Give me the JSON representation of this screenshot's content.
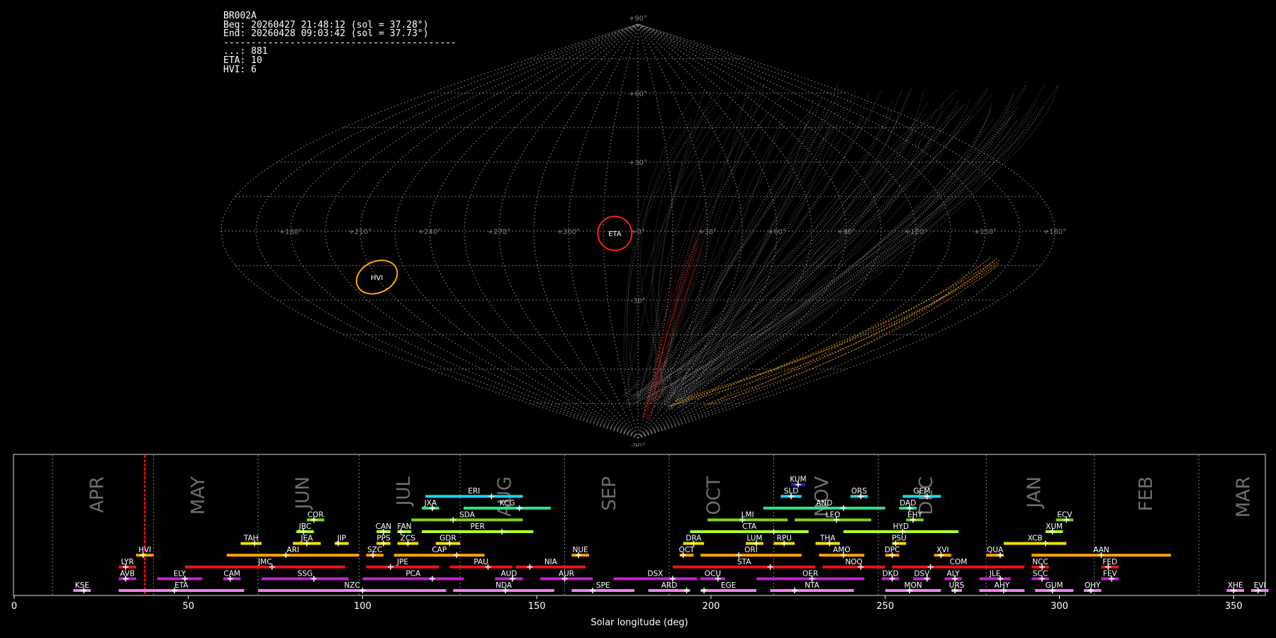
{
  "header": {
    "station": "BR002A",
    "beg": "Beg: 20260427 21:48:12 (sol = 37.28°)",
    "end": "End: 20260428 09:03:42 (sol = 37.73°)",
    "separator": "------------------------------------------",
    "counts": [
      "...: 881",
      "ETA: 10",
      "HVI: 6"
    ]
  },
  "sky_map": {
    "projection": "sinusoidal",
    "lon_labels": [
      "+180°",
      "+150°",
      "+120°",
      "+90°",
      "+60°",
      "+30°",
      "+0°",
      "+300°",
      "+270°",
      "+240°",
      "+210°",
      "+180°"
    ],
    "lat_labels": [
      "+90°",
      "+60°",
      "+30°",
      "-30°",
      "-90°"
    ],
    "active_showers": [
      {
        "code": "ETA",
        "lon": -10,
        "lat": -1,
        "color": "#ff2020"
      },
      {
        "code": "HVI",
        "lon": -120,
        "lat": -20,
        "color": "#ffa500"
      }
    ],
    "colors": {
      "grid": "#808080",
      "trails": "#9a9a9a",
      "eta": "#ff2020",
      "hvi": "#ffa500"
    }
  },
  "chart_data": {
    "type": "timeline",
    "xlabel": "Solar longitude (deg)",
    "xlim": [
      0,
      362
    ],
    "xticks": [
      0,
      50,
      100,
      150,
      200,
      250,
      300,
      350
    ],
    "current_sol": 37.5,
    "month_lines": [
      11,
      40,
      70,
      99,
      128,
      158,
      188,
      218,
      248,
      279,
      310,
      340
    ],
    "months": [
      {
        "label": "APR",
        "sol": 24
      },
      {
        "label": "MAY",
        "sol": 53
      },
      {
        "label": "JUN",
        "sol": 83
      },
      {
        "label": "JUL",
        "sol": 112
      },
      {
        "label": "AUG",
        "sol": 141
      },
      {
        "label": "SEP",
        "sol": 171
      },
      {
        "label": "OCT",
        "sol": 201
      },
      {
        "label": "NOV",
        "sol": 232
      },
      {
        "label": "DEC",
        "sol": 262
      },
      {
        "label": "JAN",
        "sol": 293
      },
      {
        "label": "FEB",
        "sol": 325
      },
      {
        "label": "MAR",
        "sol": 353
      }
    ],
    "showers": [
      {
        "code": "KSE",
        "start": 17,
        "end": 22,
        "peak": 20,
        "row": 0,
        "color": "#ee82ee"
      },
      {
        "code": "ETA",
        "start": 30,
        "end": 66,
        "peak": 46,
        "row": 0,
        "color": "#ee82ee"
      },
      {
        "code": "NZC",
        "start": 70,
        "end": 124,
        "peak": 100,
        "row": 0,
        "color": "#ee82ee"
      },
      {
        "code": "NDA",
        "start": 126,
        "end": 155,
        "peak": 141,
        "row": 0,
        "color": "#ee82ee"
      },
      {
        "code": "SPE",
        "start": 160,
        "end": 178,
        "peak": 166,
        "row": 0,
        "color": "#ee82ee"
      },
      {
        "code": "ARD",
        "start": 182,
        "end": 194,
        "peak": 193,
        "row": 0,
        "color": "#ee82ee"
      },
      {
        "code": "EGE",
        "start": 197,
        "end": 213,
        "peak": 198,
        "row": 0,
        "color": "#ee82ee"
      },
      {
        "code": "NTA",
        "start": 217,
        "end": 241,
        "peak": 224,
        "row": 0,
        "color": "#ee82ee"
      },
      {
        "code": "MON",
        "start": 250,
        "end": 266,
        "peak": 257,
        "row": 0,
        "color": "#ee82ee"
      },
      {
        "code": "URS",
        "start": 269,
        "end": 272,
        "peak": 270,
        "row": 0,
        "color": "#ee82ee"
      },
      {
        "code": "AHY",
        "start": 277,
        "end": 290,
        "peak": 284,
        "row": 0,
        "color": "#ee82ee"
      },
      {
        "code": "GUM",
        "start": 293,
        "end": 304,
        "peak": 298,
        "row": 0,
        "color": "#ee82ee"
      },
      {
        "code": "OHY",
        "start": 307,
        "end": 312,
        "peak": 309,
        "row": 0,
        "color": "#ee82ee"
      },
      {
        "code": "XHE",
        "start": 348,
        "end": 353,
        "peak": 350,
        "row": 0,
        "color": "#ee82ee"
      },
      {
        "code": "EVI",
        "start": 355,
        "end": 360,
        "peak": 357,
        "row": 0,
        "color": "#ee82ee"
      },
      {
        "code": "AVB",
        "start": 30,
        "end": 35,
        "peak": 32,
        "row": 1,
        "color": "#c71fd6"
      },
      {
        "code": "ELY",
        "start": 41,
        "end": 54,
        "peak": 49,
        "row": 1,
        "color": "#c71fd6"
      },
      {
        "code": "CAM",
        "start": 60,
        "end": 65,
        "peak": 62,
        "row": 1,
        "color": "#c71fd6"
      },
      {
        "code": "SSG",
        "start": 71,
        "end": 96,
        "peak": 86,
        "row": 1,
        "color": "#c71fd6"
      },
      {
        "code": "PCA",
        "start": 100,
        "end": 129,
        "peak": 120,
        "row": 1,
        "color": "#c71fd6"
      },
      {
        "code": "AUD",
        "start": 138,
        "end": 146,
        "peak": 143,
        "row": 1,
        "color": "#c71fd6"
      },
      {
        "code": "AUR",
        "start": 151,
        "end": 166,
        "peak": 158,
        "row": 1,
        "color": "#c71fd6"
      },
      {
        "code": "DSX",
        "start": 172,
        "end": 196,
        "peak": 189,
        "row": 1,
        "color": "#c71fd6"
      },
      {
        "code": "OCU",
        "start": 197,
        "end": 204,
        "peak": 202,
        "row": 1,
        "color": "#c71fd6"
      },
      {
        "code": "OER",
        "start": 213,
        "end": 244,
        "peak": 229,
        "row": 1,
        "color": "#c71fd6"
      },
      {
        "code": "DKD",
        "start": 249,
        "end": 254,
        "peak": 252,
        "row": 1,
        "color": "#c71fd6"
      },
      {
        "code": "DSV",
        "start": 258,
        "end": 263,
        "peak": 262,
        "row": 1,
        "color": "#c71fd6"
      },
      {
        "code": "ALY",
        "start": 267,
        "end": 272,
        "peak": 270,
        "row": 1,
        "color": "#c71fd6"
      },
      {
        "code": "JLE",
        "start": 277,
        "end": 286,
        "peak": 283,
        "row": 1,
        "color": "#c71fd6"
      },
      {
        "code": "SCC",
        "start": 292,
        "end": 297,
        "peak": 295,
        "row": 1,
        "color": "#c71fd6"
      },
      {
        "code": "FEV",
        "start": 312,
        "end": 317,
        "peak": 315,
        "row": 1,
        "color": "#c71fd6"
      },
      {
        "code": "LYR",
        "start": 30,
        "end": 35,
        "peak": 32,
        "row": 2,
        "color": "#e8170f"
      },
      {
        "code": "JMC",
        "start": 49,
        "end": 95,
        "peak": 74,
        "row": 2,
        "color": "#e8170f"
      },
      {
        "code": "JPE",
        "start": 101,
        "end": 122,
        "peak": 108,
        "row": 2,
        "color": "#e8170f"
      },
      {
        "code": "PAU",
        "start": 125,
        "end": 143,
        "peak": 136,
        "row": 2,
        "color": "#e8170f"
      },
      {
        "code": "NIA",
        "start": 144,
        "end": 164,
        "peak": 148,
        "row": 2,
        "color": "#e8170f"
      },
      {
        "code": "STA",
        "start": 189,
        "end": 230,
        "peak": 217,
        "row": 2,
        "color": "#e8170f"
      },
      {
        "code": "NOO",
        "start": 232,
        "end": 250,
        "peak": 243,
        "row": 2,
        "color": "#e8170f"
      },
      {
        "code": "COM",
        "start": 252,
        "end": 290,
        "peak": 263,
        "row": 2,
        "color": "#e8170f"
      },
      {
        "code": "NCC",
        "start": 292,
        "end": 297,
        "peak": 295,
        "row": 2,
        "color": "#e8170f"
      },
      {
        "code": "FED",
        "start": 312,
        "end": 317,
        "peak": 314,
        "row": 2,
        "color": "#e8170f"
      },
      {
        "code": "HVI",
        "start": 35,
        "end": 40,
        "peak": 37,
        "row": 3,
        "color": "#ffa500"
      },
      {
        "code": "ARI",
        "start": 61,
        "end": 99,
        "peak": 78,
        "row": 3,
        "color": "#ffa500"
      },
      {
        "code": "SZC",
        "start": 101,
        "end": 106,
        "peak": 103,
        "row": 3,
        "color": "#ffa500"
      },
      {
        "code": "CAP",
        "start": 109,
        "end": 135,
        "peak": 127,
        "row": 3,
        "color": "#ffa500"
      },
      {
        "code": "NUE",
        "start": 160,
        "end": 165,
        "peak": 162,
        "row": 3,
        "color": "#ffa500"
      },
      {
        "code": "OCT",
        "start": 191,
        "end": 195,
        "peak": 192,
        "row": 3,
        "color": "#ffa500"
      },
      {
        "code": "ORI",
        "start": 197,
        "end": 226,
        "peak": 208,
        "row": 3,
        "color": "#ffa500"
      },
      {
        "code": "AMO",
        "start": 231,
        "end": 244,
        "peak": 238,
        "row": 3,
        "color": "#ffa500"
      },
      {
        "code": "DPC",
        "start": 250,
        "end": 254,
        "peak": 252,
        "row": 3,
        "color": "#ffa500"
      },
      {
        "code": "XVI",
        "start": 264,
        "end": 269,
        "peak": 266,
        "row": 3,
        "color": "#ffa500"
      },
      {
        "code": "QUA",
        "start": 279,
        "end": 284,
        "peak": 283,
        "row": 3,
        "color": "#ffa500"
      },
      {
        "code": "AAN",
        "start": 292,
        "end": 332,
        "peak": 312,
        "row": 3,
        "color": "#ffa500"
      },
      {
        "code": "TAH",
        "start": 65,
        "end": 71,
        "peak": 69,
        "row": 4,
        "color": "#f0e000"
      },
      {
        "code": "JEA",
        "start": 80,
        "end": 88,
        "peak": 84,
        "row": 4,
        "color": "#f0e000"
      },
      {
        "code": "JIP",
        "start": 92,
        "end": 96,
        "peak": 93,
        "row": 4,
        "color": "#f0e000"
      },
      {
        "code": "PPS",
        "start": 104,
        "end": 108,
        "peak": 106,
        "row": 4,
        "color": "#f0e000"
      },
      {
        "code": "ZCS",
        "start": 110,
        "end": 116,
        "peak": 113,
        "row": 4,
        "color": "#f0e000"
      },
      {
        "code": "GDR",
        "start": 121,
        "end": 128,
        "peak": 125,
        "row": 4,
        "color": "#f0e000"
      },
      {
        "code": "DRA",
        "start": 192,
        "end": 198,
        "peak": 195,
        "row": 4,
        "color": "#f0e000"
      },
      {
        "code": "LUM",
        "start": 210,
        "end": 215,
        "peak": 213,
        "row": 4,
        "color": "#f0e000"
      },
      {
        "code": "RPU",
        "start": 218,
        "end": 224,
        "peak": 221,
        "row": 4,
        "color": "#f0e000"
      },
      {
        "code": "THA",
        "start": 230,
        "end": 237,
        "peak": 234,
        "row": 4,
        "color": "#f0e000"
      },
      {
        "code": "PSU",
        "start": 252,
        "end": 256,
        "peak": 253,
        "row": 4,
        "color": "#f0e000"
      },
      {
        "code": "XCB",
        "start": 284,
        "end": 302,
        "peak": 296,
        "row": 4,
        "color": "#f0e000"
      },
      {
        "code": "JBC",
        "start": 81,
        "end": 86,
        "peak": 83,
        "row": 5,
        "color": "#adff2f"
      },
      {
        "code": "CAN",
        "start": 104,
        "end": 108,
        "peak": 106,
        "row": 5,
        "color": "#adff2f"
      },
      {
        "code": "FAN",
        "start": 110,
        "end": 114,
        "peak": 111,
        "row": 5,
        "color": "#adff2f"
      },
      {
        "code": "PER",
        "start": 117,
        "end": 149,
        "peak": 140,
        "row": 5,
        "color": "#adff2f"
      },
      {
        "code": "CTA",
        "start": 194,
        "end": 228,
        "peak": 218,
        "row": 5,
        "color": "#adff2f"
      },
      {
        "code": "HYD",
        "start": 238,
        "end": 271,
        "peak": 255,
        "row": 5,
        "color": "#adff2f"
      },
      {
        "code": "XUM",
        "start": 296,
        "end": 301,
        "peak": 298,
        "row": 5,
        "color": "#adff2f"
      },
      {
        "code": "COR",
        "start": 84,
        "end": 89,
        "peak": 86,
        "row": 6,
        "color": "#7cd321"
      },
      {
        "code": "SDA",
        "start": 114,
        "end": 146,
        "peak": 126,
        "row": 6,
        "color": "#7cd321"
      },
      {
        "code": "LMI",
        "start": 199,
        "end": 222,
        "peak": 209,
        "row": 6,
        "color": "#7cd321"
      },
      {
        "code": "LEO",
        "start": 224,
        "end": 246,
        "peak": 236,
        "row": 6,
        "color": "#7cd321"
      },
      {
        "code": "EHY",
        "start": 256,
        "end": 261,
        "peak": 258,
        "row": 6,
        "color": "#7cd321"
      },
      {
        "code": "ECV",
        "start": 299,
        "end": 304,
        "peak": 302,
        "row": 6,
        "color": "#7cd321"
      },
      {
        "code": "JXA",
        "start": 117,
        "end": 122,
        "peak": 120,
        "row": 7,
        "color": "#2ee58a"
      },
      {
        "code": "KCG",
        "start": 129,
        "end": 154,
        "peak": 145,
        "row": 7,
        "color": "#2ee58a"
      },
      {
        "code": "AND",
        "start": 215,
        "end": 250,
        "peak": 238,
        "row": 7,
        "color": "#2ee58a"
      },
      {
        "code": "DAD",
        "start": 254,
        "end": 259,
        "peak": 257,
        "row": 7,
        "color": "#2ee58a"
      },
      {
        "code": "ERI",
        "start": 118,
        "end": 146,
        "peak": 137,
        "row": 8,
        "color": "#1ad2f0"
      },
      {
        "code": "SLD",
        "start": 220,
        "end": 226,
        "peak": 223,
        "row": 8,
        "color": "#1ad2f0"
      },
      {
        "code": "ORS",
        "start": 240,
        "end": 245,
        "peak": 243,
        "row": 8,
        "color": "#1ad2f0"
      },
      {
        "code": "GEM",
        "start": 255,
        "end": 266,
        "peak": 262,
        "row": 8,
        "color": "#1ad2f0"
      },
      {
        "code": "KUM",
        "start": 223,
        "end": 227,
        "peak": 225,
        "row": 9,
        "color": "#2020ff"
      }
    ]
  }
}
